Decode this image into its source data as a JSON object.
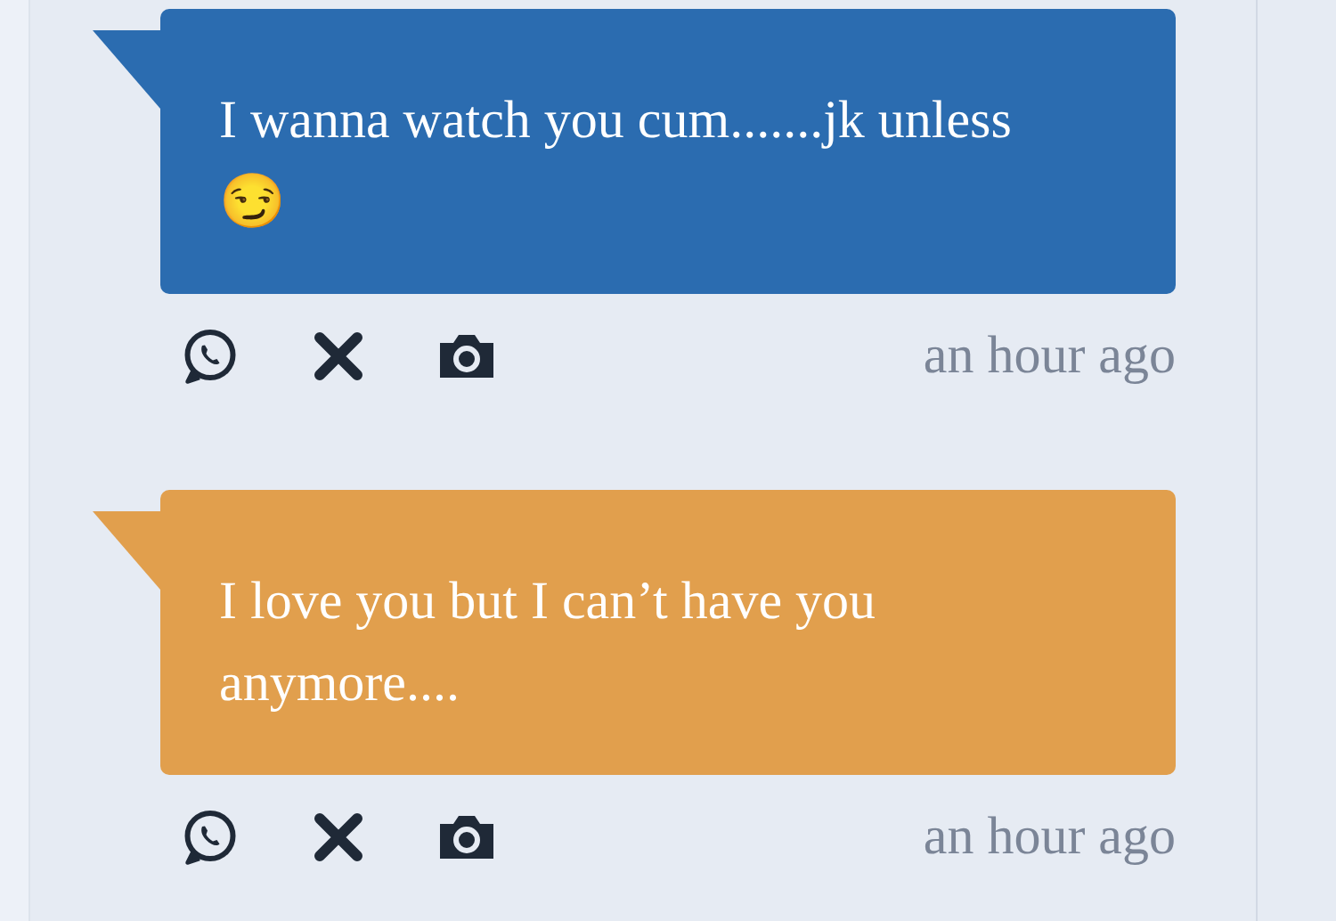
{
  "messages": [
    {
      "text": "I wanna watch you cum.......jk unless😏",
      "color": "#2b6cb0",
      "time": "an hour ago"
    },
    {
      "text": "I love you but I can’t have you anymore....",
      "color": "#e19f4d",
      "time": "an hour ago"
    }
  ]
}
